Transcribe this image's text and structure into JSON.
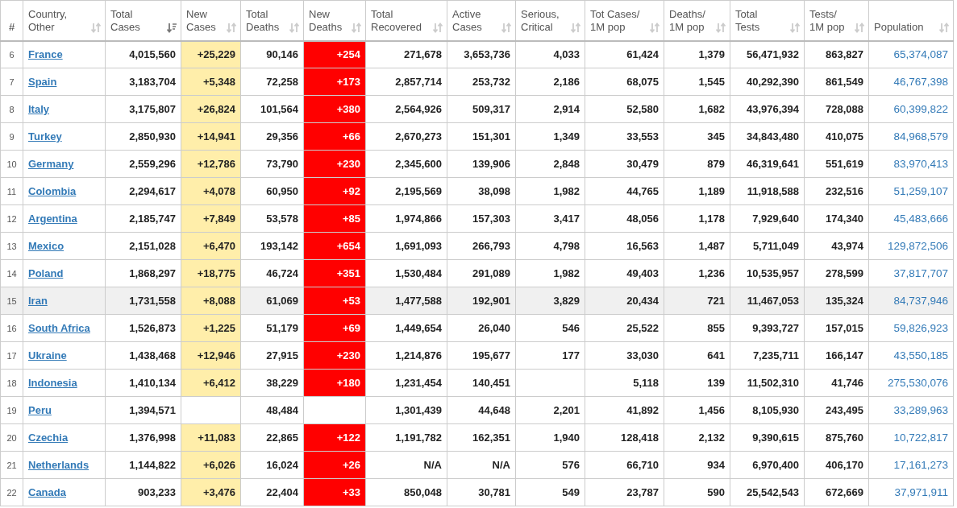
{
  "table": {
    "columns": [
      {
        "label": "#",
        "kind": "rank"
      },
      {
        "label": "Country,\nOther",
        "kind": "link",
        "sorted": false
      },
      {
        "label": "Total\nCases",
        "kind": "number",
        "sorted": true
      },
      {
        "label": "New\nCases",
        "kind": "new_cases",
        "sorted": false
      },
      {
        "label": "Total\nDeaths",
        "kind": "number",
        "sorted": false
      },
      {
        "label": "New\nDeaths",
        "kind": "new_deaths",
        "sorted": false
      },
      {
        "label": "Total\nRecovered",
        "kind": "number",
        "sorted": false
      },
      {
        "label": "Active\nCases",
        "kind": "number",
        "sorted": false
      },
      {
        "label": "Serious,\nCritical",
        "kind": "number",
        "sorted": false
      },
      {
        "label": "Tot Cases/\n1M pop",
        "kind": "number",
        "sorted": false
      },
      {
        "label": "Deaths/\n1M pop",
        "kind": "number",
        "sorted": false
      },
      {
        "label": "Total\nTests",
        "kind": "number",
        "sorted": false
      },
      {
        "label": "Tests/\n1M pop",
        "kind": "number",
        "sorted": false
      },
      {
        "label": "Population",
        "kind": "population",
        "sorted": false
      }
    ],
    "rows": [
      {
        "selected": false,
        "cells": [
          "6",
          "France",
          "4,015,560",
          "+25,229",
          "90,146",
          "+254",
          "271,678",
          "3,653,736",
          "4,033",
          "61,424",
          "1,379",
          "56,471,932",
          "863,827",
          "65,374,087"
        ]
      },
      {
        "selected": false,
        "cells": [
          "7",
          "Spain",
          "3,183,704",
          "+5,348",
          "72,258",
          "+173",
          "2,857,714",
          "253,732",
          "2,186",
          "68,075",
          "1,545",
          "40,292,390",
          "861,549",
          "46,767,398"
        ]
      },
      {
        "selected": false,
        "cells": [
          "8",
          "Italy",
          "3,175,807",
          "+26,824",
          "101,564",
          "+380",
          "2,564,926",
          "509,317",
          "2,914",
          "52,580",
          "1,682",
          "43,976,394",
          "728,088",
          "60,399,822"
        ]
      },
      {
        "selected": false,
        "cells": [
          "9",
          "Turkey",
          "2,850,930",
          "+14,941",
          "29,356",
          "+66",
          "2,670,273",
          "151,301",
          "1,349",
          "33,553",
          "345",
          "34,843,480",
          "410,075",
          "84,968,579"
        ]
      },
      {
        "selected": false,
        "cells": [
          "10",
          "Germany",
          "2,559,296",
          "+12,786",
          "73,790",
          "+230",
          "2,345,600",
          "139,906",
          "2,848",
          "30,479",
          "879",
          "46,319,641",
          "551,619",
          "83,970,413"
        ]
      },
      {
        "selected": false,
        "cells": [
          "11",
          "Colombia",
          "2,294,617",
          "+4,078",
          "60,950",
          "+92",
          "2,195,569",
          "38,098",
          "1,982",
          "44,765",
          "1,189",
          "11,918,588",
          "232,516",
          "51,259,107"
        ]
      },
      {
        "selected": false,
        "cells": [
          "12",
          "Argentina",
          "2,185,747",
          "+7,849",
          "53,578",
          "+85",
          "1,974,866",
          "157,303",
          "3,417",
          "48,056",
          "1,178",
          "7,929,640",
          "174,340",
          "45,483,666"
        ]
      },
      {
        "selected": false,
        "cells": [
          "13",
          "Mexico",
          "2,151,028",
          "+6,470",
          "193,142",
          "+654",
          "1,691,093",
          "266,793",
          "4,798",
          "16,563",
          "1,487",
          "5,711,049",
          "43,974",
          "129,872,506"
        ]
      },
      {
        "selected": false,
        "cells": [
          "14",
          "Poland",
          "1,868,297",
          "+18,775",
          "46,724",
          "+351",
          "1,530,484",
          "291,089",
          "1,982",
          "49,403",
          "1,236",
          "10,535,957",
          "278,599",
          "37,817,707"
        ]
      },
      {
        "selected": true,
        "cells": [
          "15",
          "Iran",
          "1,731,558",
          "+8,088",
          "61,069",
          "+53",
          "1,477,588",
          "192,901",
          "3,829",
          "20,434",
          "721",
          "11,467,053",
          "135,324",
          "84,737,946"
        ]
      },
      {
        "selected": false,
        "cells": [
          "16",
          "South Africa",
          "1,526,873",
          "+1,225",
          "51,179",
          "+69",
          "1,449,654",
          "26,040",
          "546",
          "25,522",
          "855",
          "9,393,727",
          "157,015",
          "59,826,923"
        ]
      },
      {
        "selected": false,
        "cells": [
          "17",
          "Ukraine",
          "1,438,468",
          "+12,946",
          "27,915",
          "+230",
          "1,214,876",
          "195,677",
          "177",
          "33,030",
          "641",
          "7,235,711",
          "166,147",
          "43,550,185"
        ]
      },
      {
        "selected": false,
        "cells": [
          "18",
          "Indonesia",
          "1,410,134",
          "+6,412",
          "38,229",
          "+180",
          "1,231,454",
          "140,451",
          null,
          "5,118",
          "139",
          "11,502,310",
          "41,746",
          "275,530,076"
        ]
      },
      {
        "selected": false,
        "cells": [
          "19",
          "Peru",
          "1,394,571",
          null,
          "48,484",
          null,
          "1,301,439",
          "44,648",
          "2,201",
          "41,892",
          "1,456",
          "8,105,930",
          "243,495",
          "33,289,963"
        ]
      },
      {
        "selected": false,
        "cells": [
          "20",
          "Czechia",
          "1,376,998",
          "+11,083",
          "22,865",
          "+122",
          "1,191,782",
          "162,351",
          "1,940",
          "128,418",
          "2,132",
          "9,390,615",
          "875,760",
          "10,722,817"
        ]
      },
      {
        "selected": false,
        "cells": [
          "21",
          "Netherlands",
          "1,144,822",
          "+6,026",
          "16,024",
          "+26",
          "N/A",
          "N/A",
          "576",
          "66,710",
          "934",
          "6,970,400",
          "406,170",
          "17,161,273"
        ]
      },
      {
        "selected": false,
        "cells": [
          "22",
          "Canada",
          "903,233",
          "+3,476",
          "22,404",
          "+33",
          "850,048",
          "30,781",
          "549",
          "23,787",
          "590",
          "25,542,543",
          "672,669",
          "37,971,911"
        ]
      }
    ]
  }
}
